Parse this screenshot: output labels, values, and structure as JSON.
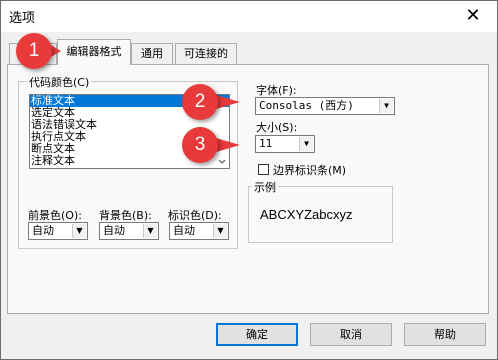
{
  "window": {
    "title": "选项",
    "close_glyph": "✕"
  },
  "tabs": [
    {
      "label": "编辑器格式",
      "active": true
    },
    {
      "label": "通用",
      "active": false
    },
    {
      "label": "可连接的",
      "active": false
    }
  ],
  "code_colors": {
    "legend": "代码颜色(C)",
    "items": [
      "标准文本",
      "选定文本",
      "语法错误文本",
      "执行点文本",
      "断点文本",
      "注释文本"
    ],
    "selected_index": 0,
    "foreground": {
      "label": "前景色(O):",
      "value": "自动"
    },
    "background": {
      "label": "背景色(B):",
      "value": "自动"
    },
    "indicator": {
      "label": "标识色(D):",
      "value": "自动"
    }
  },
  "font": {
    "label": "字体(F):",
    "value": "Consolas (西方)"
  },
  "size": {
    "label": "大小(S):",
    "value": "11"
  },
  "margin_indicator": {
    "label": "边界标识条(M)",
    "checked": false
  },
  "sample": {
    "legend": "示例",
    "text": "ABCXYZabcxyz"
  },
  "buttons": {
    "ok": "确定",
    "cancel": "取消",
    "help": "帮助"
  },
  "callouts": [
    "1",
    "2",
    "3"
  ],
  "colors": {
    "selection": "#0078d7",
    "callout": "#e83a3a"
  }
}
